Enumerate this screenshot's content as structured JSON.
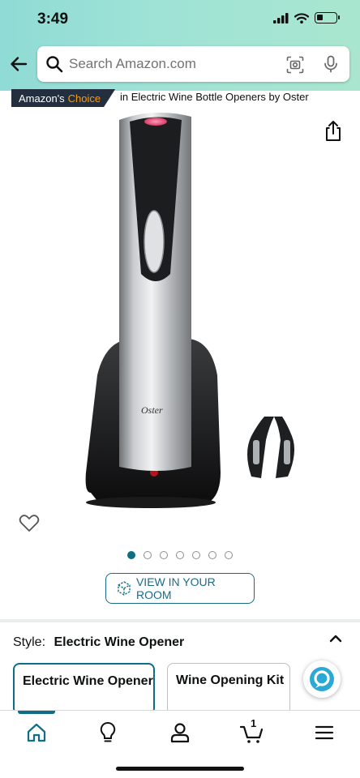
{
  "status_bar": {
    "time": "3:49"
  },
  "search": {
    "placeholder": "Search Amazon.com"
  },
  "badge": {
    "amazons": "Amazon's",
    "choice": "Choice",
    "context": "in Electric Wine Bottle Openers by Oster"
  },
  "product": {
    "brand_logo": "Oster",
    "image_count": 7,
    "active_image": 1
  },
  "view_in_room": {
    "label": "VIEW IN YOUR ROOM"
  },
  "style": {
    "label": "Style:",
    "selected": "Electric Wine Opener",
    "options": [
      {
        "label": "Electric Wine Opener",
        "selected": true
      },
      {
        "label": "Wine Opening Kit",
        "selected": false
      }
    ]
  },
  "nav": {
    "cart_count": "1"
  },
  "colors": {
    "accent": "#0e6e85",
    "badge_bg": "#232f3e",
    "choice_orange": "#ff9900"
  }
}
